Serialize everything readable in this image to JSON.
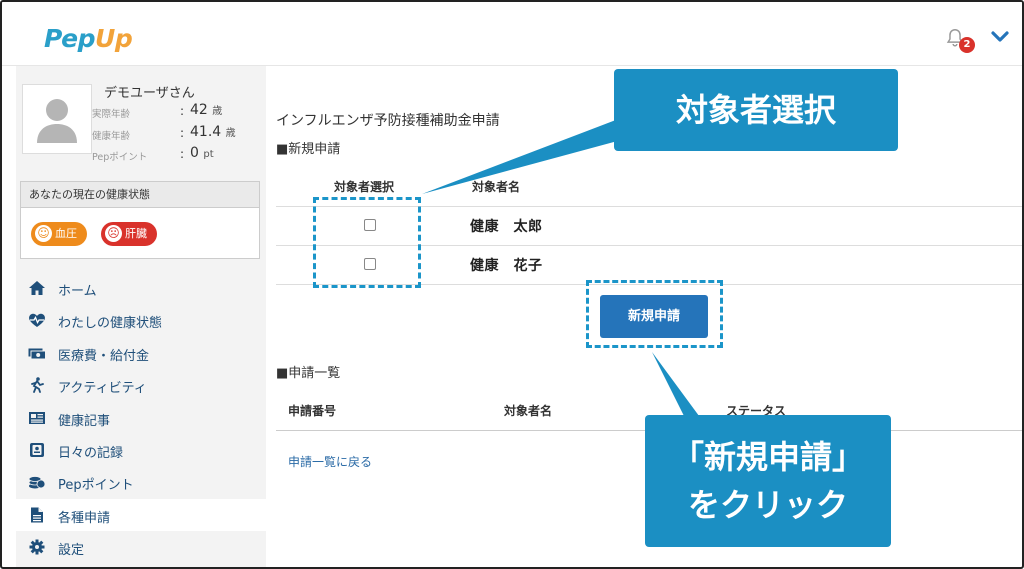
{
  "header": {
    "logo_part1": "Pep",
    "logo_part2": "Up",
    "notification_count": "2"
  },
  "sidebar": {
    "user_name": "デモユーザさん",
    "stats": [
      {
        "label": "実際年齢",
        "value": "42",
        "unit": "歳"
      },
      {
        "label": "健康年齢",
        "value": "41.4",
        "unit": "歳"
      },
      {
        "label": "Pepポイント",
        "value": "0",
        "unit": "pt"
      }
    ],
    "health_title": "あなたの現在の健康状態",
    "health_tags": [
      {
        "label": "血圧",
        "face": "☺",
        "color": "#ee8b1c"
      },
      {
        "label": "肝臓",
        "face": "☹",
        "color": "#d9322b"
      }
    ],
    "nav": [
      {
        "label": "ホーム",
        "icon": "home-icon"
      },
      {
        "label": "わたしの健康状態",
        "icon": "heartbeat-icon"
      },
      {
        "label": "医療費・給付金",
        "icon": "money-icon"
      },
      {
        "label": "アクティビティ",
        "icon": "running-icon"
      },
      {
        "label": "健康記事",
        "icon": "newspaper-icon"
      },
      {
        "label": "日々の記録",
        "icon": "record-icon"
      },
      {
        "label": "Pepポイント",
        "icon": "coins-icon"
      },
      {
        "label": "各種申請",
        "icon": "document-icon",
        "active": true
      },
      {
        "label": "設定",
        "icon": "gear-icon"
      }
    ]
  },
  "main": {
    "page_title": "インフルエンザ予防接種補助金申請",
    "new_section": "■新規申請",
    "col_select": "対象者選択",
    "col_name": "対象者名",
    "persons": [
      "健康　太郎",
      "健康　花子"
    ],
    "new_button": "新規申請",
    "list_section": "■申請一覧",
    "list_cols": [
      "申請番号",
      "対象者名",
      "ステータス"
    ],
    "back_link": "申請一覧に戻る"
  },
  "annotations": {
    "callout1": "対象者選択",
    "callout2_line1": "「新規申請」",
    "callout2_line2": "をクリック",
    "accent": "#1b8fc3"
  }
}
